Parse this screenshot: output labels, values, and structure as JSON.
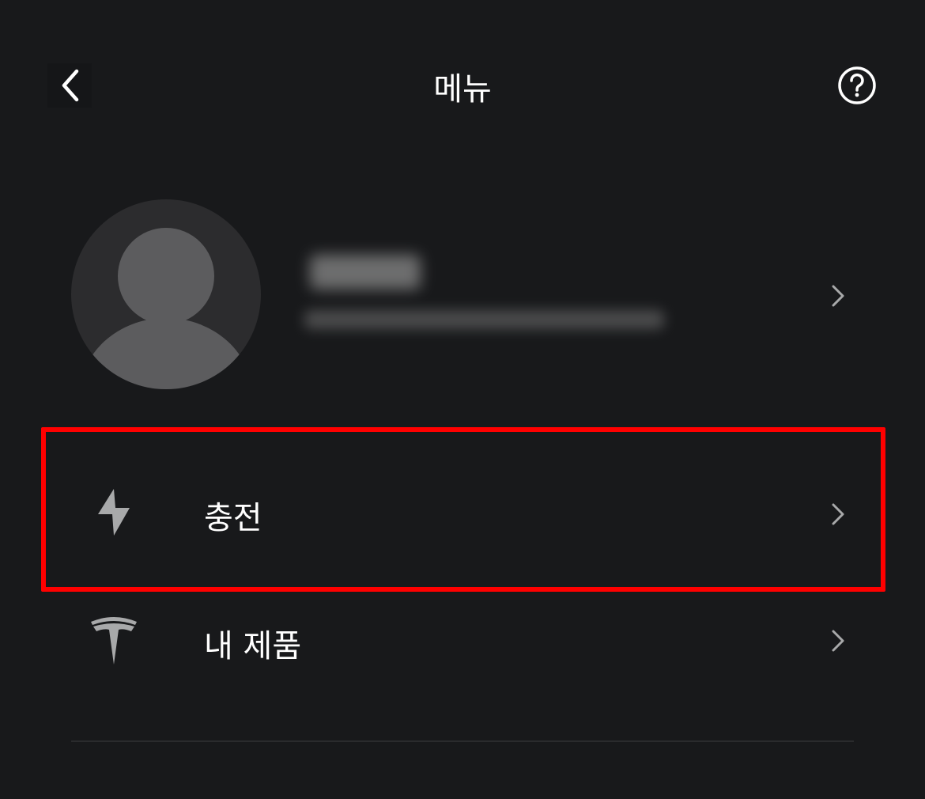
{
  "header": {
    "title": "메뉴",
    "back_icon": "chevron-left-icon",
    "help_icon": "question-circle-icon"
  },
  "profile": {
    "avatar_icon": "user-avatar-icon",
    "chevron_icon": "chevron-right-icon"
  },
  "menu": {
    "items": [
      {
        "label": "충전",
        "icon": "lightning-bolt-icon",
        "highlighted": true
      },
      {
        "label": "내 제품",
        "icon": "tesla-logo-icon",
        "highlighted": false
      }
    ]
  },
  "colors": {
    "background": "#18191b",
    "highlight": "#ff0000",
    "icon_gray": "#a8a9aa"
  }
}
